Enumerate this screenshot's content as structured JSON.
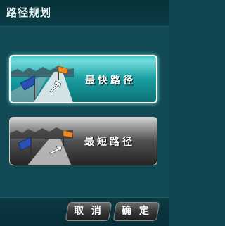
{
  "header": {
    "title": "路径规划"
  },
  "options": [
    {
      "label": "最快路径",
      "selected": true
    },
    {
      "label": "最短路径",
      "selected": false
    }
  ],
  "footer": {
    "cancel_label": "取 消",
    "ok_label": "确 定"
  },
  "colors": {
    "selected_accent": "#1aa0a3",
    "background": "#114a55"
  }
}
